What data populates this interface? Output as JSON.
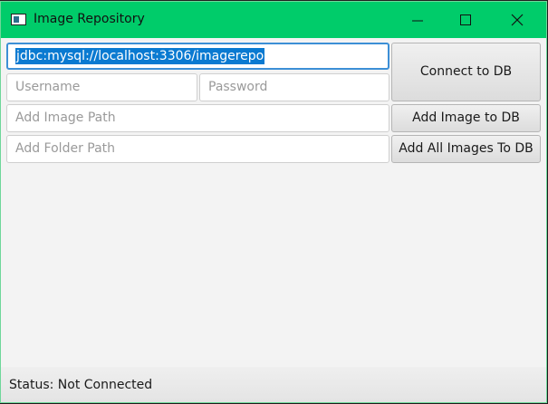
{
  "window": {
    "title": "Image Repository",
    "icon": "app-window-icon",
    "controls": [
      "minimize-icon",
      "maximize-icon",
      "close-icon"
    ],
    "accent_color": "#00cc6a"
  },
  "form": {
    "db_url_value": "jdbc:mysql://localhost:3306/imagerepo",
    "username_placeholder": "Username",
    "password_placeholder": "Password",
    "image_path_placeholder": "Add Image Path",
    "folder_path_placeholder": "Add Folder Path"
  },
  "buttons": {
    "connect": "Connect to DB",
    "add_image": "Add Image to DB",
    "add_all_images": "Add All Images To DB"
  },
  "status": {
    "text": "Status: Not Connected"
  }
}
